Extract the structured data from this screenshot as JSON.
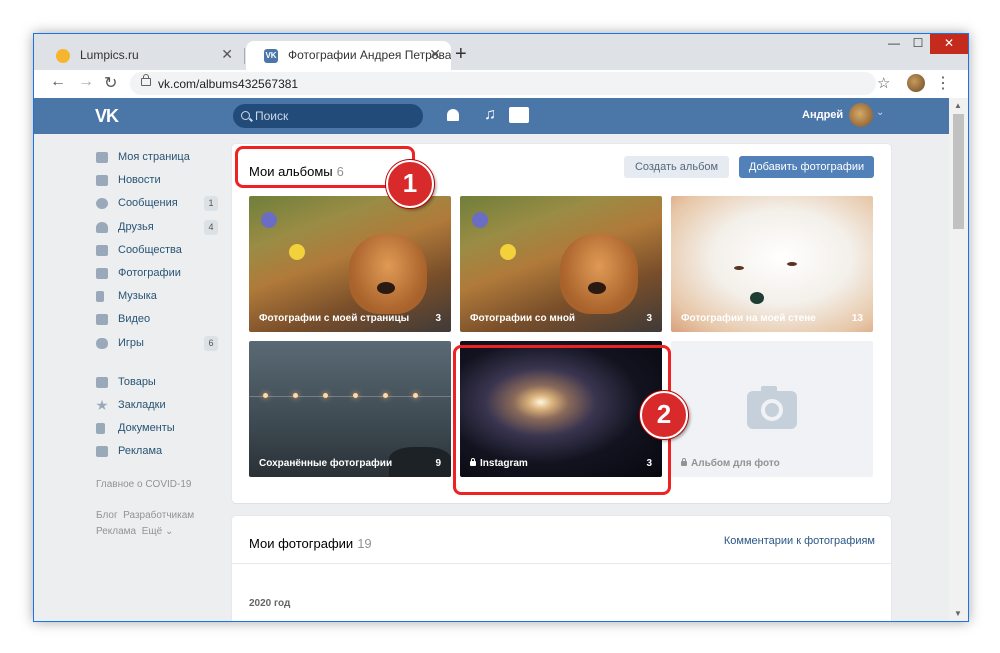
{
  "browser": {
    "tabs": [
      {
        "title": "Lumpics.ru"
      },
      {
        "title": "Фотографии Андрея Петрова –"
      }
    ],
    "new_tab": "+",
    "close": "✕",
    "url": "vk.com/albums432567381",
    "controls": {
      "minimize": "—",
      "maximize": "☐",
      "close": "✕"
    }
  },
  "vk": {
    "logo": "VK",
    "search_placeholder": "Поиск",
    "user_name": "Андрей",
    "sidebar": [
      {
        "label": "Моя страница"
      },
      {
        "label": "Новости"
      },
      {
        "label": "Сообщения",
        "badge": "1"
      },
      {
        "label": "Друзья",
        "badge": "4"
      },
      {
        "label": "Сообщества"
      },
      {
        "label": "Фотографии"
      },
      {
        "label": "Музыка"
      },
      {
        "label": "Видео"
      },
      {
        "label": "Игры",
        "badge": "6"
      },
      {
        "label": "Товары"
      },
      {
        "label": "Закладки"
      },
      {
        "label": "Документы"
      },
      {
        "label": "Реклама"
      }
    ],
    "covid_link": "Главное о COVID-19",
    "footer": {
      "blog": "Блог",
      "devs": "Разработчикам",
      "ads": "Реклама",
      "more": "Ещё"
    }
  },
  "albums": {
    "title": "Мои альбомы",
    "count": "6",
    "create_button": "Создать альбом",
    "add_button": "Добавить фотографии",
    "items": [
      {
        "name": "Фотографии с моей страницы",
        "count": "3"
      },
      {
        "name": "Фотографии со мной",
        "count": "3"
      },
      {
        "name": "Фотографии на моей стене",
        "count": "13"
      },
      {
        "name": "Сохранённые фотографии",
        "count": "9"
      },
      {
        "name": "Instagram",
        "count": "3"
      },
      {
        "name": "Альбом для фото",
        "count": ""
      }
    ]
  },
  "photos": {
    "title": "Мои фотографии",
    "count": "19",
    "comments_link": "Комментарии к фотографиям",
    "year": "2020 год"
  },
  "annotations": {
    "one": "1",
    "two": "2"
  },
  "colors": {
    "vk_blue": "#4a76a8",
    "button_blue": "#5181b8",
    "highlight_red": "#e22222"
  }
}
